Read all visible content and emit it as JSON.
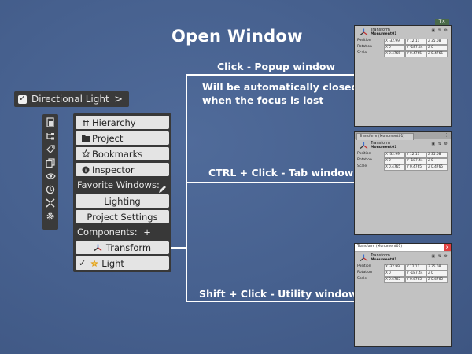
{
  "title": "Open Window",
  "captions": {
    "popup": "Click - Popup window",
    "popup_note": "Will be automatically closed when the focus is lost",
    "tab": "CTRL + Click - Tab window",
    "utility": "Shift + Click - Utility window"
  },
  "header": {
    "label": "Directional Light",
    "checked": true
  },
  "toolbar_icons": [
    "scene-icon",
    "hierarchy-icon",
    "tags-icon",
    "copy-icon",
    "visibility-icon",
    "history-icon",
    "expand-icon",
    "settings-icon"
  ],
  "menu": {
    "buttons": [
      {
        "label": "Hierarchy",
        "icon": "hash-icon"
      },
      {
        "label": "Project",
        "icon": "folder-icon"
      },
      {
        "label": "Bookmarks",
        "icon": "star-icon"
      },
      {
        "label": "Inspector",
        "icon": "info-icon"
      }
    ],
    "favorites_label": "Favorite Windows:",
    "favorites": [
      "Lighting",
      "Project Settings"
    ],
    "components_label": "Components:",
    "components_add": "+",
    "components": [
      {
        "label": "Transform",
        "icon": "transform-icon"
      },
      {
        "label": "Light",
        "icon": "light-icon",
        "checked": true
      }
    ]
  },
  "windows": {
    "popup": {
      "tool": "T",
      "controls": "x"
    },
    "tab": {
      "tab_title": "Transform (Monument01)"
    },
    "utility": {
      "bar_title": "Transform (Monument01)",
      "close": "x"
    },
    "component": {
      "name": "Transform",
      "object": "Monument01",
      "position_label": "Position",
      "rotation_label": "Rotation",
      "scale_label": "Scale",
      "position": [
        "-32.99",
        "12.11",
        "35.08"
      ],
      "rotation": [
        "0",
        "-187.44",
        "0"
      ],
      "scale": [
        "0.4765",
        "0.4765",
        "0.4765"
      ]
    }
  }
}
